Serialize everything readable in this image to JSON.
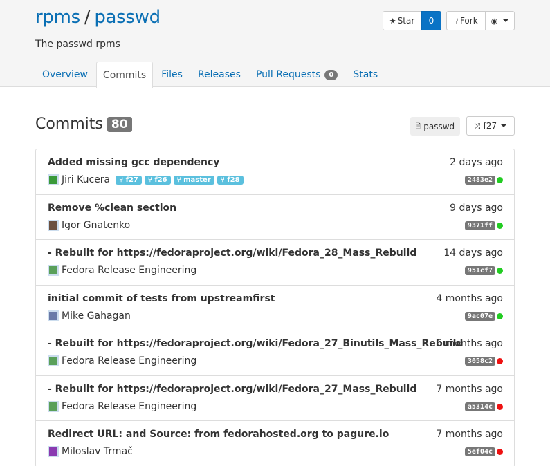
{
  "repo": {
    "namespace": "rpms",
    "separator": "/",
    "name": "passwd",
    "description": "The passwd rpms"
  },
  "actions": {
    "star_icon": "★",
    "star_label": "Star",
    "star_count": "0",
    "fork_icon": "⑂",
    "fork_label": "Fork",
    "watch_icon": "◉"
  },
  "tabs": [
    {
      "label": "Overview"
    },
    {
      "label": "Commits"
    },
    {
      "label": "Files"
    },
    {
      "label": "Releases"
    },
    {
      "label": "Pull Requests",
      "badge": "0"
    },
    {
      "label": "Stats"
    }
  ],
  "commits_section": {
    "title": "Commits",
    "count": "80",
    "branch_label_icon": "🗎",
    "branch_label": "passwd",
    "branch_select_icon": "⤨",
    "branch_select": "f27"
  },
  "colors": {
    "link": "#0a6fb4",
    "status_green": "#22cc22",
    "status_red": "#ee1111",
    "tag_bg": "#5bc0de"
  },
  "commits": [
    {
      "message": "Added missing gcc dependency",
      "author": "Jiri Kucera",
      "date": "2 days ago",
      "hash": "2483e2",
      "status": "green",
      "tags": [
        "f27",
        "f26",
        "master",
        "f28"
      ],
      "avatar_color": "#3a9a3a"
    },
    {
      "message": "Remove %clean section",
      "author": "Igor Gnatenko",
      "date": "9 days ago",
      "hash": "9371ff",
      "status": "green",
      "tags": [],
      "avatar_color": "#6b5040"
    },
    {
      "message": "- Rebuilt for https://fedoraproject.org/wiki/Fedora_28_Mass_Rebuild",
      "author": "Fedora Release Engineering",
      "date": "14 days ago",
      "hash": "951cf7",
      "status": "green",
      "tags": [],
      "avatar_color": "#5aa05a"
    },
    {
      "message": "initial commit of tests from upstreamfirst",
      "author": "Mike Gahagan",
      "date": "4 months ago",
      "hash": "9ac07e",
      "status": "green",
      "tags": [],
      "avatar_color": "#6a7aa8"
    },
    {
      "message": "- Rebuilt for https://fedoraproject.org/wiki/Fedora_27_Binutils_Mass_Rebuild",
      "author": "Fedora Release Engineering",
      "date": "6 months ago",
      "hash": "3058c2",
      "status": "red",
      "tags": [],
      "avatar_color": "#5aa05a"
    },
    {
      "message": "- Rebuilt for https://fedoraproject.org/wiki/Fedora_27_Mass_Rebuild",
      "author": "Fedora Release Engineering",
      "date": "7 months ago",
      "hash": "a5314c",
      "status": "red",
      "tags": [],
      "avatar_color": "#5aa05a"
    },
    {
      "message": "Redirect URL: and Source: from fedorahosted.org to pagure.io",
      "author": "Miloslav Trmač",
      "date": "7 months ago",
      "hash": "5ef04c",
      "status": "red",
      "tags": [],
      "avatar_color": "#8a3ab0"
    }
  ]
}
